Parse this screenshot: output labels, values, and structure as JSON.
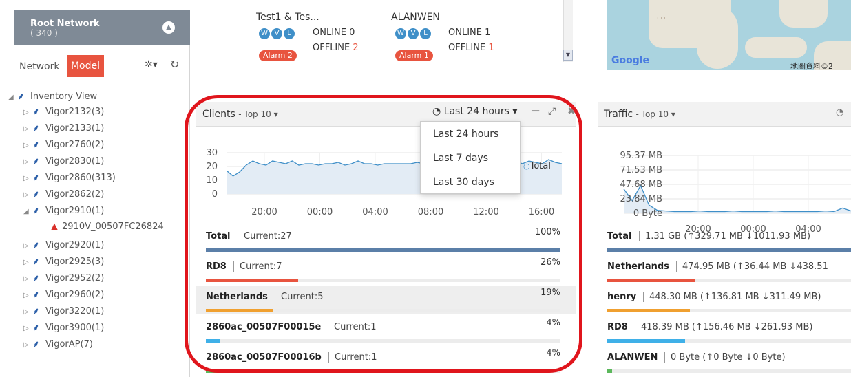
{
  "sidebar": {
    "root_title": "Root Network",
    "root_count": "( 340 )",
    "tabs": {
      "network": "Network",
      "model": "Model"
    },
    "tree": {
      "root": "Inventory View",
      "items": [
        "Vigor2132(3)",
        "Vigor2133(1)",
        "Vigor2760(2)",
        "Vigor2830(1)",
        "Vigor2860(313)",
        "Vigor2862(2)",
        "Vigor2910(1)",
        "2910V_00507FC26824",
        "Vigor2920(1)",
        "Vigor2925(3)",
        "Vigor2952(2)",
        "Vigor2960(2)",
        "Vigor3220(1)",
        "Vigor3900(1)",
        "VigorAP(7)"
      ]
    }
  },
  "top_devices": [
    {
      "name": "Test1 & Tes...",
      "online": "ONLINE 0",
      "offline_label": "OFFLINE",
      "offline_count": "2",
      "alarm": "Alarm 2"
    },
    {
      "name": "ALANWEN",
      "online": "ONLINE 1",
      "offline_label": "OFFLINE",
      "offline_count": "1",
      "alarm": "Alarm 1"
    }
  ],
  "wvl_badges": [
    "W",
    "V",
    "L"
  ],
  "map": {
    "logo": "Google",
    "data_label": "地圖資料©2"
  },
  "clients": {
    "title": "Clients",
    "subtitle": "- Top 10",
    "time_range": "Last 24 hours",
    "dropdown_options": [
      "Last 24 hours",
      "Last 7 days",
      "Last 30 days"
    ],
    "legend": "Total",
    "rows": [
      {
        "name": "Total",
        "current": "Current:27",
        "pct": "100%",
        "fraction": 1.0,
        "color": "#5b7fa8"
      },
      {
        "name": "RD8",
        "current": "Current:7",
        "pct": "26%",
        "fraction": 0.26,
        "color": "#e8543f"
      },
      {
        "name": "Netherlands",
        "current": "Current:5",
        "pct": "19%",
        "fraction": 0.19,
        "color": "#f0a030"
      },
      {
        "name": "2860ac_00507F00015e",
        "current": "Current:1",
        "pct": "4%",
        "fraction": 0.04,
        "color": "#3fb0e8"
      },
      {
        "name": "2860ac_00507F00016b",
        "current": "Current:1",
        "pct": "4%",
        "fraction": 0.04,
        "color": "#5cb85c"
      }
    ]
  },
  "traffic": {
    "title": "Traffic",
    "subtitle": "- Top 10",
    "rows": [
      {
        "name": "Total",
        "detail": "1.31 GB (↑329.71 MB ↓1011.93 MB)",
        "fraction": 1.0,
        "color": "#5b7fa8"
      },
      {
        "name": "Netherlands",
        "detail": "474.95 MB (↑36.44 MB ↓438.51",
        "fraction": 0.36,
        "color": "#e8543f"
      },
      {
        "name": "henry",
        "detail": "448.30 MB (↑136.81 MB ↓311.49 MB)",
        "fraction": 0.34,
        "color": "#f0a030"
      },
      {
        "name": "RD8",
        "detail": "418.39 MB (↑156.46 MB ↓261.93 MB)",
        "fraction": 0.32,
        "color": "#3fb0e8"
      },
      {
        "name": "ALANWEN",
        "detail": "0 Byte (↑0 Byte ↓0 Byte)",
        "fraction": 0.02,
        "color": "#5cb85c"
      }
    ]
  },
  "chart_data": [
    {
      "type": "area",
      "x_ticks": [
        "20:00",
        "00:00",
        "04:00",
        "08:00",
        "12:00",
        "16:00"
      ],
      "y_ticks": [
        "0",
        "10",
        "20",
        "30"
      ],
      "ylim": [
        0,
        30
      ],
      "series": [
        {
          "name": "Total",
          "values": [
            17,
            13,
            16,
            21,
            24,
            22,
            21,
            24,
            23,
            22,
            24,
            21,
            22,
            22,
            21,
            22,
            22,
            23,
            21,
            22,
            24,
            22,
            22,
            21,
            22,
            22,
            22,
            22,
            22,
            23,
            22,
            24,
            22,
            22,
            23,
            24,
            25,
            23,
            22,
            24,
            23,
            24,
            22,
            25,
            24,
            22,
            24,
            23,
            22,
            25,
            23,
            22
          ]
        }
      ]
    },
    {
      "type": "area",
      "x_ticks": [
        "20:00",
        "00:00",
        "04:00"
      ],
      "y_ticks": [
        "0 Byte",
        "23.84 MB",
        "47.68 MB",
        "71.53 MB",
        "95.37 MB"
      ],
      "ylim": [
        0,
        100
      ],
      "series": [
        {
          "values": [
            42,
            22,
            48,
            14,
            5,
            4,
            3,
            3,
            3,
            4,
            3,
            3,
            3,
            4,
            3,
            3,
            3,
            3,
            4,
            3,
            3,
            3,
            3,
            3,
            4,
            3,
            9,
            4
          ]
        }
      ]
    }
  ],
  "colors": {
    "accent": "#e8543f",
    "highlight": "#e0151c",
    "chart_line": "#3f8fc8"
  }
}
